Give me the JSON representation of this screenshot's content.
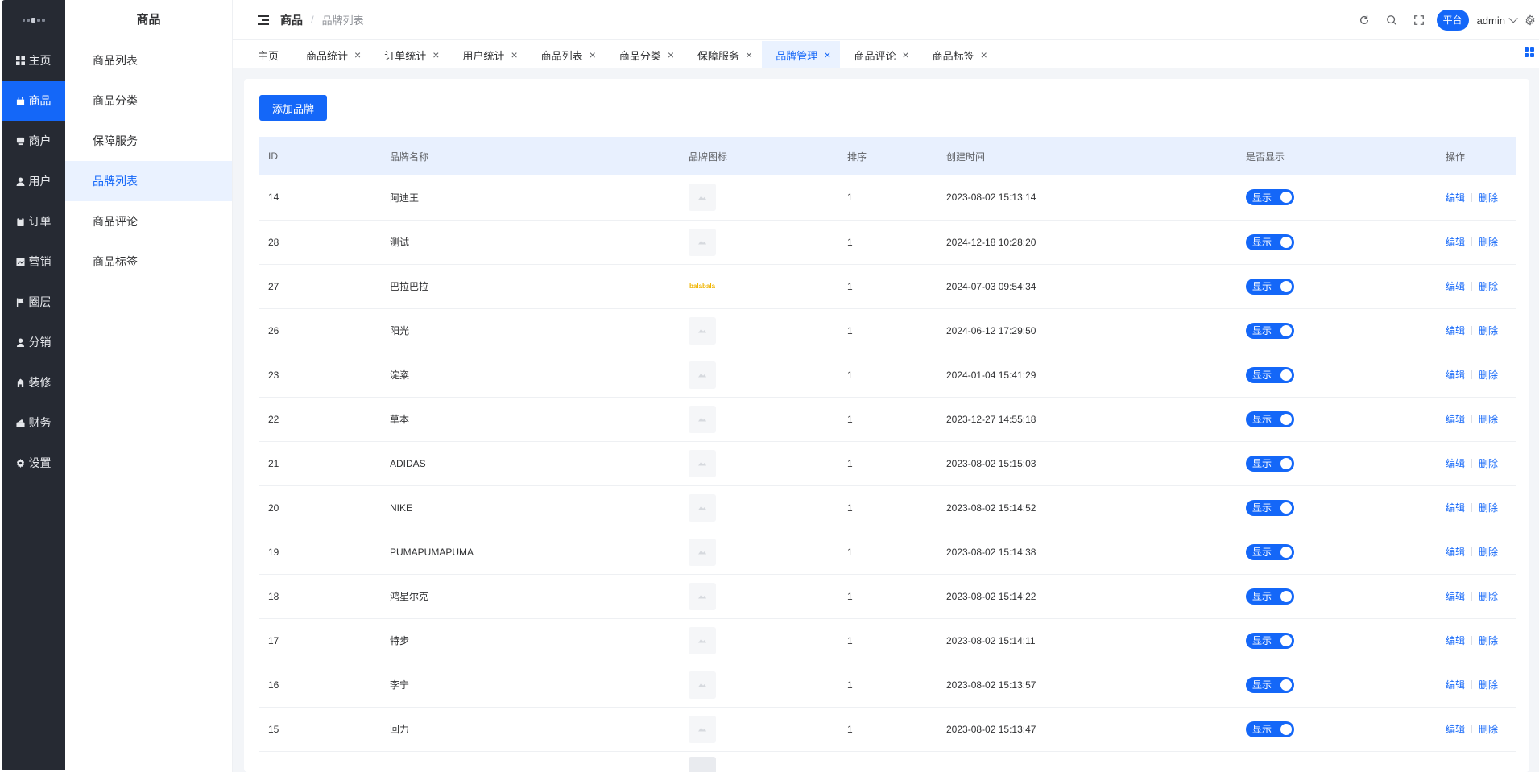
{
  "nav": [
    {
      "label": "主页",
      "icon": "grid-icon",
      "active": false
    },
    {
      "label": "商品",
      "icon": "bag-icon",
      "active": true
    },
    {
      "label": "商户",
      "icon": "store-icon",
      "active": false
    },
    {
      "label": "用户",
      "icon": "user-icon",
      "active": false
    },
    {
      "label": "订单",
      "icon": "clipboard-icon",
      "active": false
    },
    {
      "label": "营销",
      "icon": "chart-icon",
      "active": false
    },
    {
      "label": "圈层",
      "icon": "flag-icon",
      "active": false
    },
    {
      "label": "分销",
      "icon": "person-icon",
      "active": false
    },
    {
      "label": "装修",
      "icon": "home-icon",
      "active": false
    },
    {
      "label": "财务",
      "icon": "finance-icon",
      "active": false
    },
    {
      "label": "设置",
      "icon": "gear-icon",
      "active": false
    }
  ],
  "submenu": {
    "title": "商品",
    "items": [
      {
        "label": "商品列表",
        "active": false
      },
      {
        "label": "商品分类",
        "active": false
      },
      {
        "label": "保障服务",
        "active": false
      },
      {
        "label": "品牌列表",
        "active": true
      },
      {
        "label": "商品评论",
        "active": false
      },
      {
        "label": "商品标签",
        "active": false
      }
    ]
  },
  "header": {
    "breadcrumb_main": "商品",
    "breadcrumb_sep": "/",
    "breadcrumb_sub": "品牌列表",
    "platform_label": "平台",
    "user_name": "admin"
  },
  "tabs": [
    {
      "label": "主页",
      "closable": false,
      "active": false
    },
    {
      "label": "商品统计",
      "closable": true,
      "active": false
    },
    {
      "label": "订单统计",
      "closable": true,
      "active": false
    },
    {
      "label": "用户统计",
      "closable": true,
      "active": false
    },
    {
      "label": "商品列表",
      "closable": true,
      "active": false
    },
    {
      "label": "商品分类",
      "closable": true,
      "active": false
    },
    {
      "label": "保障服务",
      "closable": true,
      "active": false
    },
    {
      "label": "品牌管理",
      "closable": true,
      "active": true
    },
    {
      "label": "商品评论",
      "closable": true,
      "active": false
    },
    {
      "label": "商品标签",
      "closable": true,
      "active": false
    }
  ],
  "toolbar": {
    "add_label": "添加品牌"
  },
  "table": {
    "columns": [
      "ID",
      "品牌名称",
      "品牌图标",
      "排序",
      "创建时间",
      "是否显示",
      "操作"
    ],
    "rows": [
      {
        "id": "14",
        "name": "阿迪王",
        "logo": "placeholder",
        "sort": "1",
        "created": "2023-08-02 15:13:14",
        "show": "显示"
      },
      {
        "id": "28",
        "name": "测试",
        "logo": "placeholder",
        "sort": "1",
        "created": "2024-12-18 10:28:20",
        "show": "显示"
      },
      {
        "id": "27",
        "name": "巴拉巴拉",
        "logo": "brand",
        "logo_text": "balabala",
        "sort": "1",
        "created": "2024-07-03 09:54:34",
        "show": "显示"
      },
      {
        "id": "26",
        "name": "阳光",
        "logo": "placeholder",
        "sort": "1",
        "created": "2024-06-12 17:29:50",
        "show": "显示"
      },
      {
        "id": "23",
        "name": "淀粢",
        "logo": "placeholder",
        "sort": "1",
        "created": "2024-01-04 15:41:29",
        "show": "显示"
      },
      {
        "id": "22",
        "name": "草本",
        "logo": "placeholder",
        "sort": "1",
        "created": "2023-12-27 14:55:18",
        "show": "显示"
      },
      {
        "id": "21",
        "name": "ADIDAS",
        "logo": "placeholder",
        "sort": "1",
        "created": "2023-08-02 15:15:03",
        "show": "显示"
      },
      {
        "id": "20",
        "name": "NIKE",
        "logo": "placeholder",
        "sort": "1",
        "created": "2023-08-02 15:14:52",
        "show": "显示"
      },
      {
        "id": "19",
        "name": "PUMAPUMAPUMA",
        "logo": "placeholder",
        "sort": "1",
        "created": "2023-08-02 15:14:38",
        "show": "显示"
      },
      {
        "id": "18",
        "name": "鸿星尔克",
        "logo": "placeholder",
        "sort": "1",
        "created": "2023-08-02 15:14:22",
        "show": "显示"
      },
      {
        "id": "17",
        "name": "特步",
        "logo": "placeholder",
        "sort": "1",
        "created": "2023-08-02 15:14:11",
        "show": "显示"
      },
      {
        "id": "16",
        "name": "李宁",
        "logo": "placeholder",
        "sort": "1",
        "created": "2023-08-02 15:13:57",
        "show": "显示"
      },
      {
        "id": "15",
        "name": "回力",
        "logo": "placeholder",
        "sort": "1",
        "created": "2023-08-02 15:13:47",
        "show": "显示"
      }
    ],
    "edit_label": "编辑",
    "delete_label": "删除"
  },
  "colors": {
    "accent": "#1467f8",
    "sidebar_bg": "#262a33",
    "header_row_bg": "#e8f0fe",
    "active_sub_bg": "#eaf2ff"
  }
}
